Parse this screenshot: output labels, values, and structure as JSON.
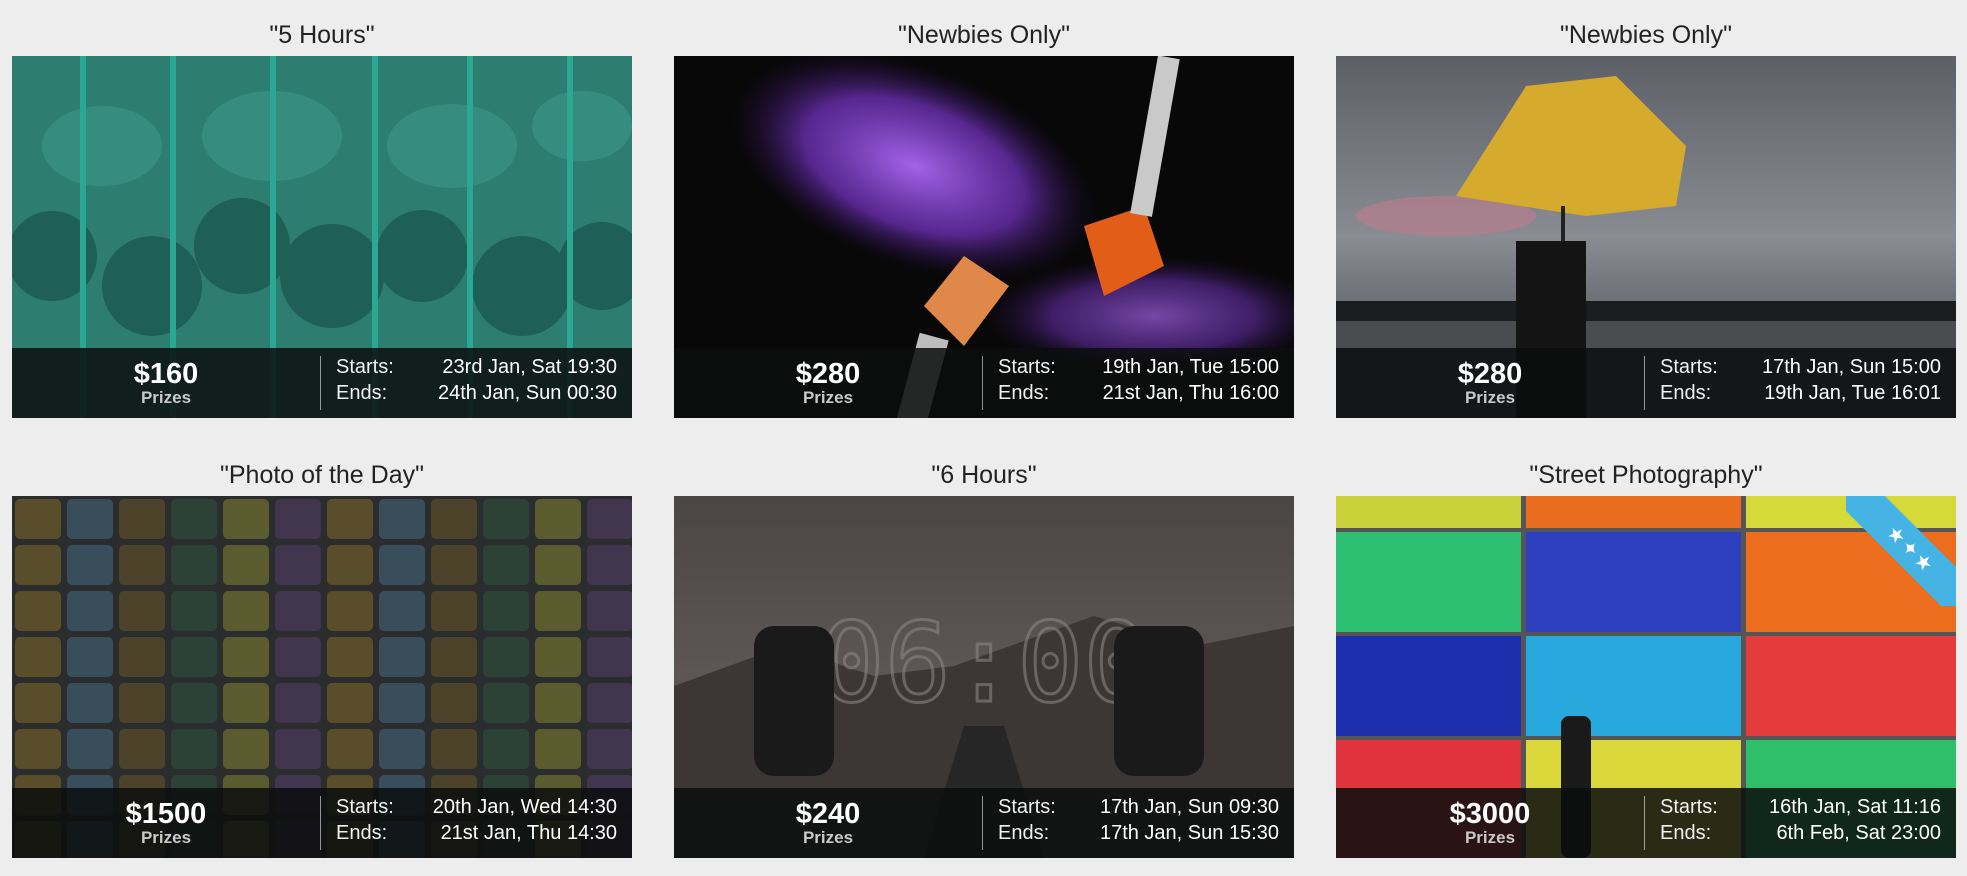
{
  "contests": [
    {
      "title": "\"5 Hours\"",
      "prize_amount": "$160",
      "prize_label": "Prizes",
      "starts_label": "Starts:",
      "starts_value": "23rd Jan, Sat 19:30",
      "ends_label": "Ends:",
      "ends_value": "24th Jan, Sun 00:30",
      "image": "teal-camera-strips"
    },
    {
      "title": "\"Newbies Only\"",
      "prize_amount": "$280",
      "prize_label": "Prizes",
      "starts_label": "Starts:",
      "starts_value": "19th Jan, Tue 15:00",
      "ends_label": "Ends:",
      "ends_value": "21st Jan, Thu 16:00",
      "image": "makeup-brushes-purple-powder"
    },
    {
      "title": "\"Newbies Only\"",
      "prize_amount": "$280",
      "prize_label": "Prizes",
      "starts_label": "Starts:",
      "starts_value": "17th Jan, Sun 15:00",
      "ends_label": "Ends:",
      "ends_value": "19th Jan, Tue 16:01",
      "image": "yellow-umbrella-lake"
    },
    {
      "title": "\"Photo of the Day\"",
      "prize_amount": "$1500",
      "prize_label": "Prizes",
      "starts_label": "Starts:",
      "starts_value": "20th Jan, Wed 14:30",
      "ends_label": "Ends:",
      "ends_value": "21st Jan, Thu 14:30",
      "image": "photo-tile-wall"
    },
    {
      "title": "\"6 Hours\"",
      "prize_amount": "$240",
      "prize_label": "Prizes",
      "starts_label": "Starts:",
      "starts_value": "17th Jan, Sun 09:30",
      "ends_label": "Ends:",
      "ends_value": "17th Jan, Sun 15:30",
      "clock_text": "06:00",
      "image": "photographers-road-clock"
    },
    {
      "title": "\"Street Photography\"",
      "prize_amount": "$3000",
      "prize_label": "Prizes",
      "starts_label": "Starts:",
      "starts_value": "16th Jan, Sat 11:16",
      "ends_label": "Ends:",
      "ends_value": "6th Feb, Sat 23:00",
      "image": "colorful-wall-walker",
      "ribbon_icon": "award-stars-icon"
    }
  ],
  "colors": {
    "teal": "#1f8a7a",
    "ribbon": "#45b3e4",
    "infobar": "#0c0e0e"
  }
}
